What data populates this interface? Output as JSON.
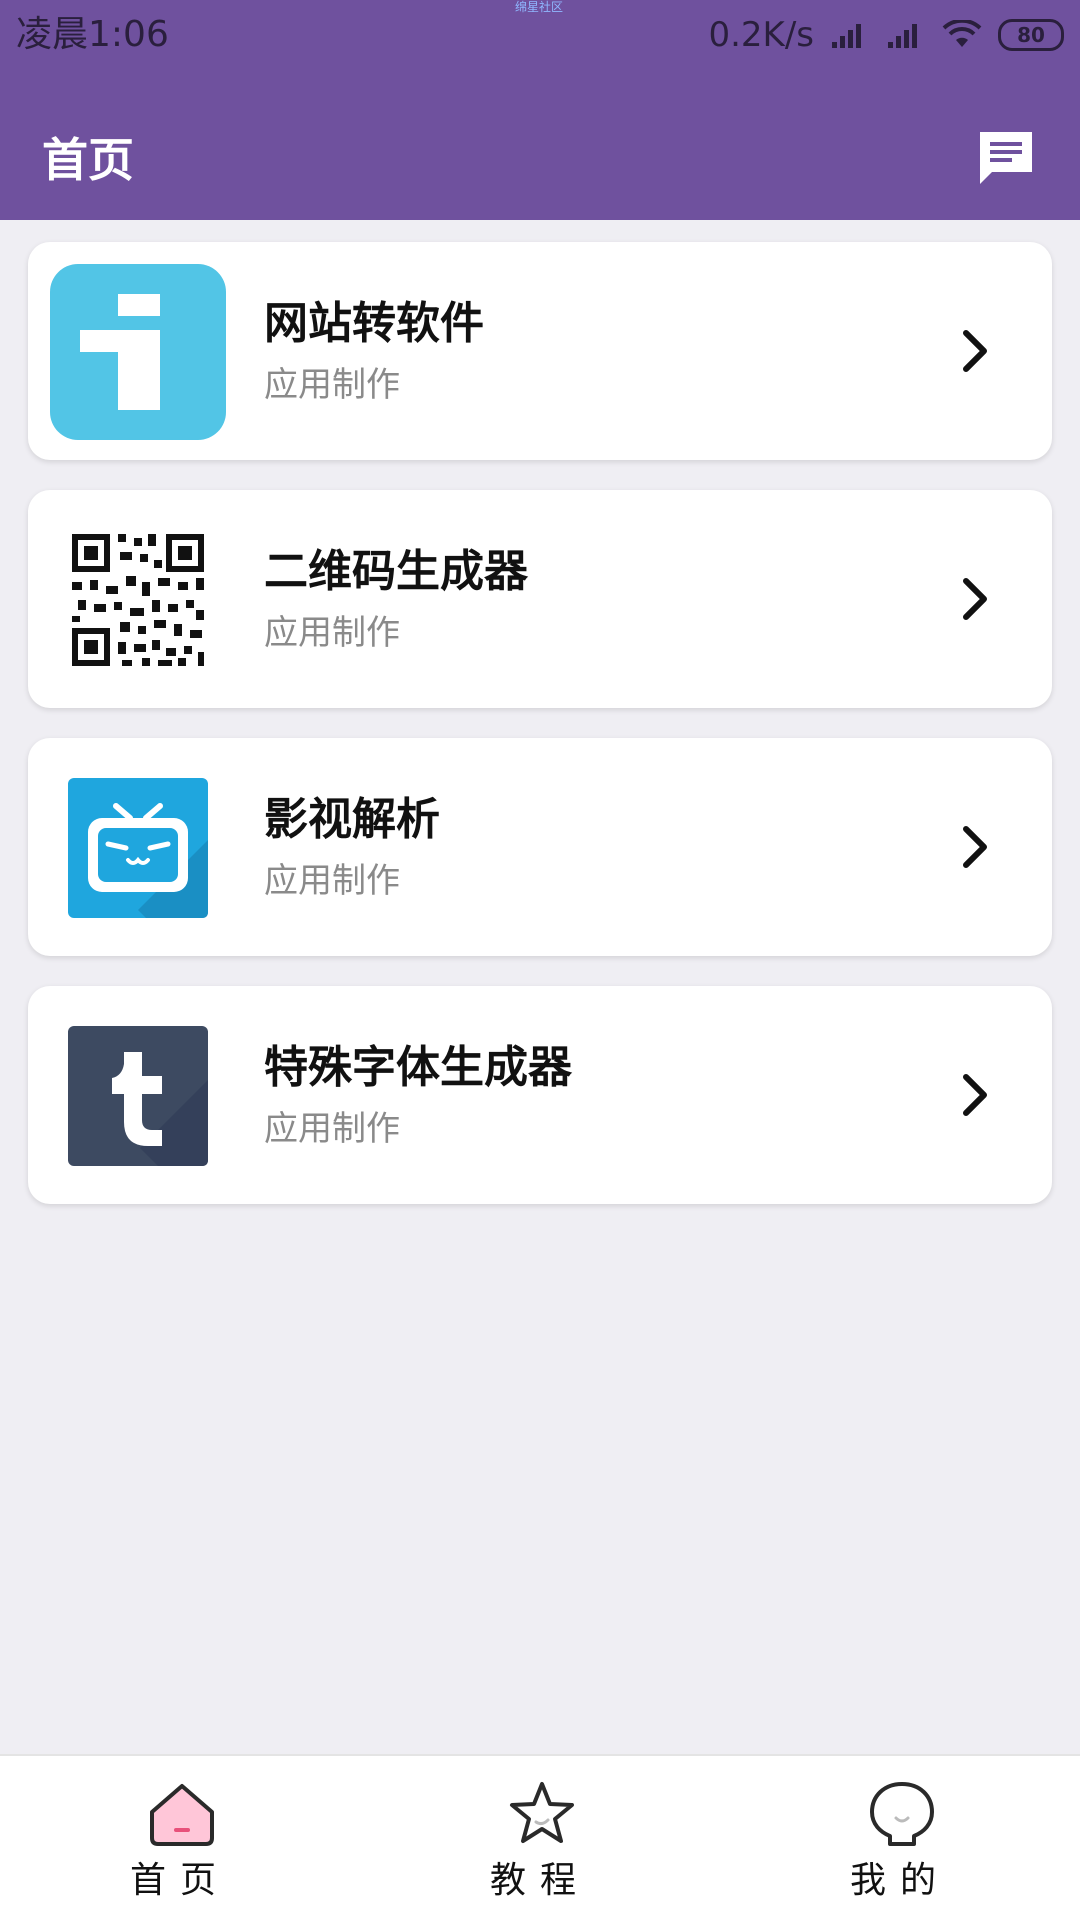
{
  "status_bar": {
    "time": "凌晨1:06",
    "watermark": "绵星社区",
    "net_speed": "0.2K/s",
    "battery": "80"
  },
  "header": {
    "title": "首页",
    "message_icon": "message-icon"
  },
  "items": [
    {
      "title": "网站转软件",
      "subtitle": "应用制作",
      "icon": "web-to-app-icon"
    },
    {
      "title": "二维码生成器",
      "subtitle": "应用制作",
      "icon": "qr-code-icon"
    },
    {
      "title": "影视解析",
      "subtitle": "应用制作",
      "icon": "tv-icon"
    },
    {
      "title": "特殊字体生成器",
      "subtitle": "应用制作",
      "icon": "t-letter-icon"
    }
  ],
  "bottom_nav": {
    "tabs": [
      {
        "label": "首页",
        "icon": "home-icon",
        "active": true
      },
      {
        "label": "教程",
        "icon": "star-icon"
      },
      {
        "label": "我的",
        "icon": "profile-icon"
      }
    ]
  },
  "colors": {
    "header": "#6f519e",
    "background": "#efeef3",
    "icon_blue": "#52c5e6",
    "tv_blue": "#1fa6de",
    "t_dark": "#3d4a61"
  }
}
